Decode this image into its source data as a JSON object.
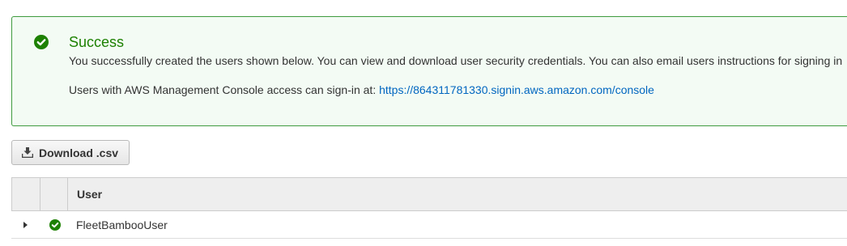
{
  "alert": {
    "status_icon": "check-circle-icon",
    "title": "Success",
    "message": "You successfully created the users shown below. You can view and download user security credentials. You can also email users instructions for signing in",
    "signin_prefix": "Users with AWS Management Console access can sign-in at: ",
    "signin_url": "https://864311781330.signin.aws.amazon.com/console",
    "color": "#1d8102"
  },
  "download": {
    "icon": "download-icon",
    "label": "Download .csv"
  },
  "table": {
    "columns": [
      "",
      "",
      "User"
    ],
    "rows": [
      {
        "expand_icon": "caret-right-icon",
        "status_icon": "check-circle-icon",
        "user": "FleetBambooUser"
      }
    ]
  }
}
